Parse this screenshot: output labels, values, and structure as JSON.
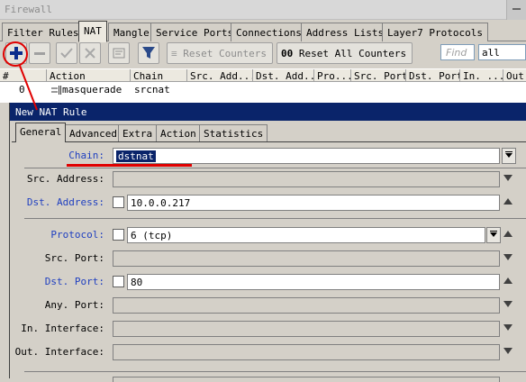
{
  "window": {
    "title": "Firewall"
  },
  "tabs": [
    {
      "label": "Filter Rules"
    },
    {
      "label": "NAT"
    },
    {
      "label": "Mangle"
    },
    {
      "label": "Service Ports"
    },
    {
      "label": "Connections"
    },
    {
      "label": "Address Lists"
    },
    {
      "label": "Layer7 Protocols"
    }
  ],
  "toolbar": {
    "reset_counters": "Reset Counters",
    "reset_all_prefix": "00",
    "reset_all_counters": "Reset All Counters",
    "find_placeholder": "Find",
    "filter_value": "all"
  },
  "table": {
    "columns": [
      "#",
      "Action",
      "Chain",
      "Src. Add...",
      "Dst. Add...",
      "Pro...",
      "Src. Port",
      "Dst. Port",
      "In. ...",
      "Out."
    ],
    "rows": [
      {
        "num": "0",
        "action": "masquerade",
        "chain": "srcnat"
      }
    ]
  },
  "dialog": {
    "title": "New NAT Rule",
    "tabs": [
      {
        "label": "General"
      },
      {
        "label": "Advanced"
      },
      {
        "label": "Extra"
      },
      {
        "label": "Action"
      },
      {
        "label": "Statistics"
      }
    ],
    "fields": {
      "chain": {
        "label": "Chain:",
        "value": "dstnat"
      },
      "src_address": {
        "label": "Src. Address:",
        "value": ""
      },
      "dst_address": {
        "label": "Dst. Address:",
        "value": "10.0.0.217"
      },
      "protocol": {
        "label": "Protocol:",
        "value": "6 (tcp)"
      },
      "src_port": {
        "label": "Src. Port:",
        "value": ""
      },
      "dst_port": {
        "label": "Dst. Port:",
        "value": "80"
      },
      "any_port": {
        "label": "Any. Port:",
        "value": ""
      },
      "in_interface": {
        "label": "In. Interface:",
        "value": ""
      },
      "out_interface": {
        "label": "Out. Interface:",
        "value": ""
      }
    }
  },
  "colors": {
    "annotation": "#e00000",
    "dialog_title_bg": "#0a246a",
    "field_label_blue": "#1f3fc0"
  },
  "icons": [
    "add-icon",
    "remove-icon",
    "enable-icon",
    "disable-icon",
    "comment-icon",
    "filter-icon",
    "reset-counters-icon",
    "firewall-rule-icon"
  ]
}
